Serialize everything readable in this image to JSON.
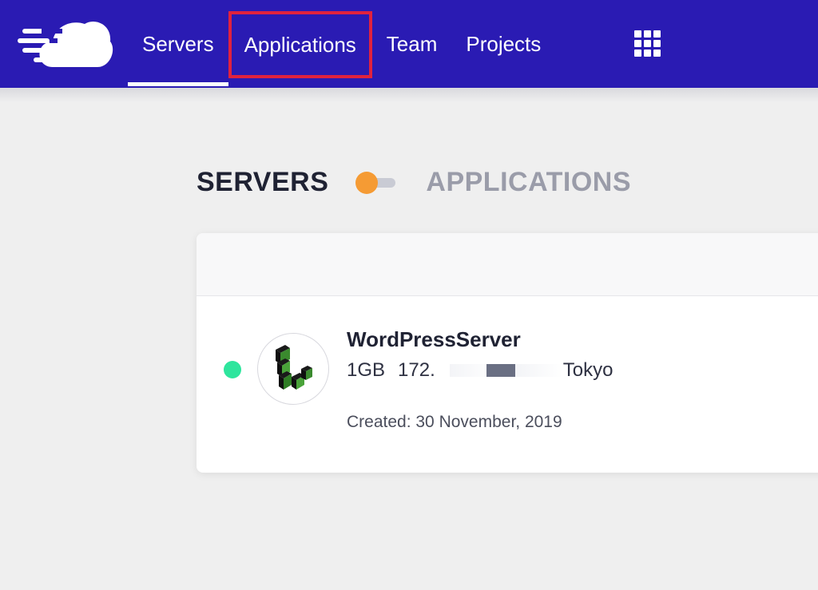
{
  "nav": {
    "items": [
      {
        "label": "Servers"
      },
      {
        "label": "Applications"
      },
      {
        "label": "Team"
      },
      {
        "label": "Projects"
      }
    ]
  },
  "toggle": {
    "left_label": "SERVERS",
    "right_label": "APPLICATIONS"
  },
  "server": {
    "name": "WordPressServer",
    "size": "1GB",
    "ip_prefix": "172.",
    "location": "Tokyo",
    "created": "Created: 30 November, 2019"
  },
  "colors": {
    "topbar": "#2a1bb3",
    "highlight_box": "#e0223e",
    "toggle_knob": "#f59b34",
    "status_online": "#2ee59d"
  },
  "icons": {
    "brand": "cloudways-cloud-logo",
    "apps": "grid-icon",
    "provider": "linode-logo"
  }
}
